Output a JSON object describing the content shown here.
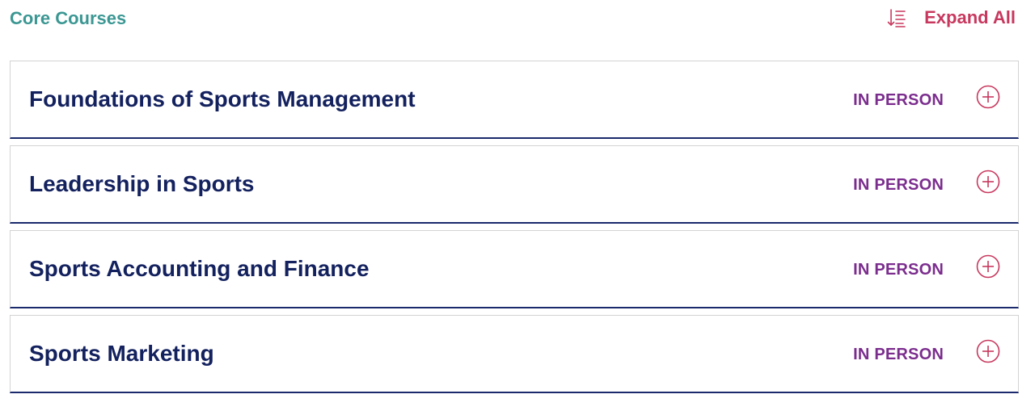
{
  "header": {
    "title": "Core Courses",
    "expand_all_label": "Expand All",
    "expand_icon": "sort-descending-list-icon"
  },
  "courses": [
    {
      "title": "Foundations of Sports Management",
      "mode": "IN PERSON",
      "toggle_icon": "plus-circle-icon"
    },
    {
      "title": "Leadership in Sports",
      "mode": "IN PERSON",
      "toggle_icon": "plus-circle-icon"
    },
    {
      "title": "Sports Accounting and Finance",
      "mode": "IN PERSON",
      "toggle_icon": "plus-circle-icon"
    },
    {
      "title": "Sports Marketing",
      "mode": "IN PERSON",
      "toggle_icon": "plus-circle-icon"
    }
  ],
  "colors": {
    "section_title": "#3b9793",
    "accent": "#c8385e",
    "course_title": "#13215e",
    "mode_label": "#7b2d8e",
    "item_divider": "#1a2a6c"
  }
}
